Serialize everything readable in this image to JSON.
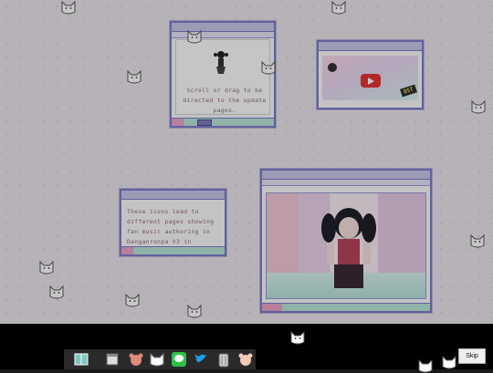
{
  "windows": {
    "instructions": {
      "text": "Scroll or drag to be directed to the update pages."
    },
    "links_note": {
      "text": "These icons lead to different pages showing fan music authoring in Danganronpa V3 in"
    },
    "video": {
      "badge": "OST"
    }
  },
  "skip_label": "Skip",
  "colors": {
    "window_border": "#7d7dc9",
    "accent_pink": "#e9a4c9",
    "accent_mint": "#b9e6d8",
    "desktop_bg": "#e9e4ec"
  },
  "icons": {
    "desktop_cats": "cat-face-icon",
    "taskbar": [
      "book-icon",
      "window-icon",
      "bear-icon",
      "cat-face-icon",
      "chat-icon",
      "bird-icon",
      "trash-can-icon",
      "bear-icon"
    ]
  }
}
